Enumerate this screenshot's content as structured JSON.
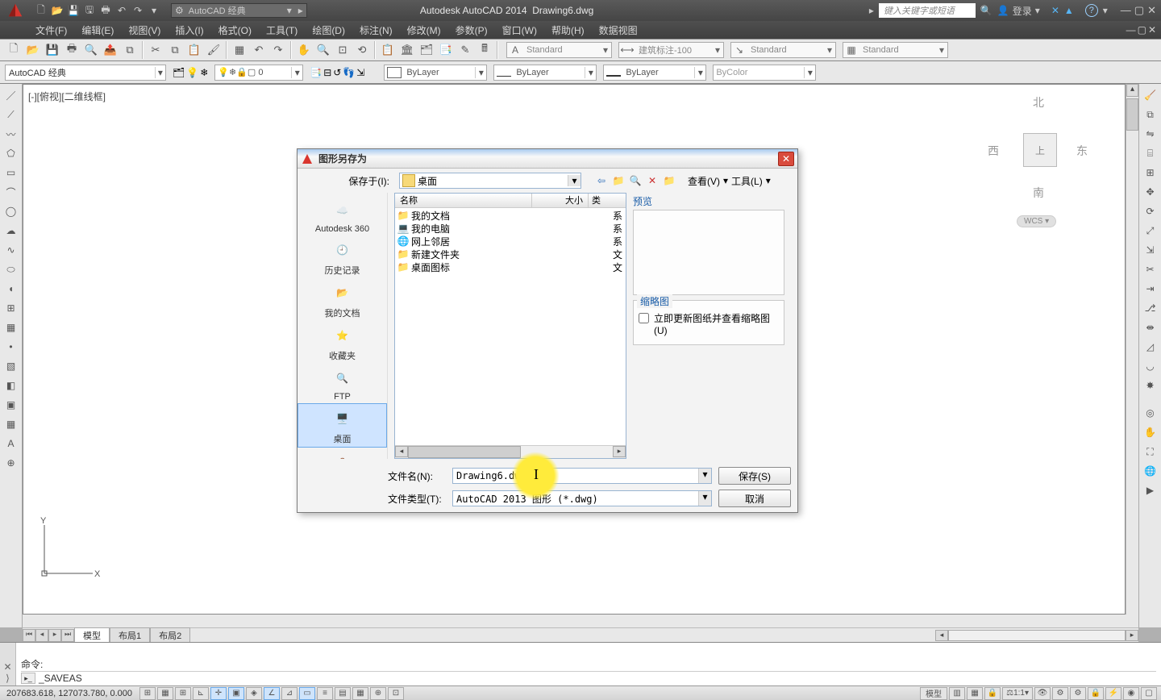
{
  "title_bar": {
    "app": "Autodesk AutoCAD 2014",
    "doc": "Drawing6.dwg",
    "workspace": "AutoCAD 经典",
    "search_placeholder": "键入关键字或短语",
    "login": "登录"
  },
  "menus": {
    "file": "文件(F)",
    "edit": "编辑(E)",
    "view": "视图(V)",
    "insert": "插入(I)",
    "format": "格式(O)",
    "tools": "工具(T)",
    "draw": "绘图(D)",
    "dim": "标注(N)",
    "modify": "修改(M)",
    "param": "参数(P)",
    "window": "窗口(W)",
    "help": "帮助(H)",
    "dataview": "数据视图"
  },
  "style_panels": {
    "text": "Standard",
    "dim": "建筑标注-100",
    "mleader": "Standard",
    "table": "Standard"
  },
  "layer_row": {
    "layer": "AutoCAD 经典",
    "color": "ByLayer",
    "ltype": "ByLayer",
    "lweight": "ByLayer",
    "plot": "ByColor",
    "current_layer_state": "0"
  },
  "viewport": {
    "label": "[-][俯视][二维线框]"
  },
  "viewcube": {
    "n": "北",
    "s": "南",
    "e": "东",
    "w": "西",
    "top": "上",
    "wcs": "WCS"
  },
  "tabs": {
    "model": "模型",
    "layout1": "布局1",
    "layout2": "布局2"
  },
  "command": {
    "label": "命令:",
    "echo": "_SAVEAS"
  },
  "status": {
    "coords": "207683.618, 127073.780, 0.000",
    "model": "模型",
    "scale": "1:1"
  },
  "dialog": {
    "title": "图形另存为",
    "save_in_label": "保存于(I):",
    "look_in": "桌面",
    "view_menu": "查看(V)",
    "tools_menu": "工具(L)",
    "places": {
      "a360": "Autodesk 360",
      "history": "历史记录",
      "mydoc": "我的文档",
      "fav": "收藏夹",
      "ftp": "FTP",
      "desktop": "桌面"
    },
    "headers": {
      "name": "名称",
      "size": "大小",
      "type": "类"
    },
    "rows": [
      {
        "name": "我的文档",
        "type": "系"
      },
      {
        "name": "我的电脑",
        "type": "系"
      },
      {
        "name": "网上邻居",
        "type": "系"
      },
      {
        "name": "新建文件夹",
        "type": "文"
      },
      {
        "name": "桌面图标",
        "type": "文"
      }
    ],
    "preview_label": "预览",
    "thumb_group": "缩略图",
    "thumb_check": "立即更新图纸并查看缩略图(U)",
    "file_name_label": "文件名(N):",
    "file_name": "Drawing6.dwg",
    "file_type_label": "文件类型(T):",
    "file_type": "AutoCAD 2013 图形 (*.dwg)",
    "save_btn": "保存(S)",
    "cancel_btn": "取消"
  }
}
